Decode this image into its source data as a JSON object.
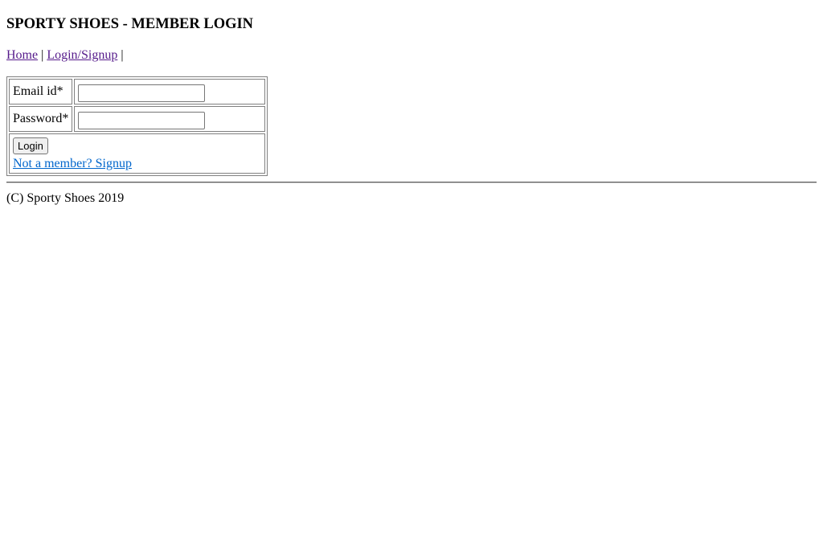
{
  "header": {
    "title": "SPORTY SHOES - MEMBER LOGIN"
  },
  "nav": {
    "items": [
      {
        "label": "Home"
      },
      {
        "label": "Login/Signup"
      }
    ],
    "separator": "|"
  },
  "login_form": {
    "email_label": "Email id*",
    "email_value": "",
    "email_placeholder": "",
    "password_label": "Password*",
    "password_value": "",
    "password_placeholder": "",
    "login_button_label": "Login",
    "signup_link_label": "Not a member? Signup"
  },
  "footer": {
    "text": "(C) Sporty Shoes 2019"
  },
  "colors": {
    "visited_link": "#551a8b",
    "link": "#0066cc",
    "text": "#000000",
    "background": "#ffffff"
  }
}
